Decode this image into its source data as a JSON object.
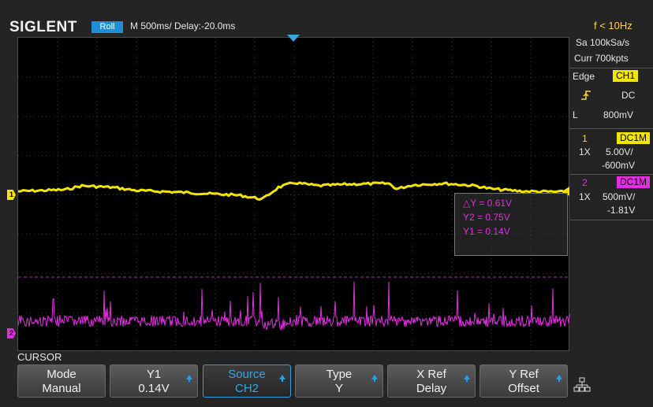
{
  "header": {
    "brand": "SIGLENT",
    "mode": "Roll",
    "timebase": "M 500ms/  Delay:-20.0ms",
    "frequency": "f < 10Hz"
  },
  "acquisition": {
    "sample_rate": "Sa 100kSa/s",
    "memory_depth": "Curr 700kpts"
  },
  "trigger": {
    "type": "Edge",
    "source": "CH1",
    "slope_icon": "rising-edge-icon",
    "coupling": "DC",
    "level_label": "L",
    "level": "800mV"
  },
  "channels": [
    {
      "number": "1",
      "coupling": "DC1M",
      "probe": "1X",
      "scale": "5.00V/",
      "offset": "-600mV",
      "color": "#f2e600",
      "marker": "1"
    },
    {
      "number": "2",
      "coupling": "DC1M",
      "probe": "1X",
      "scale": "500mV/",
      "offset": "-1.81V",
      "color": "#e22ee2",
      "marker": "2"
    }
  ],
  "cursor_readout": {
    "delta_y": "△Y = 0.61V",
    "y2": "Y2 = 0.75V",
    "y1": "Y1 = 0.14V"
  },
  "menu": {
    "title": "CURSOR",
    "softkeys": [
      {
        "line1": "Mode",
        "line2": "Manual"
      },
      {
        "line1": "Y1",
        "line2": "0.14V"
      },
      {
        "line1": "Source",
        "line2": "CH2"
      },
      {
        "line1": "Type",
        "line2": "Y"
      },
      {
        "line1": "X Ref",
        "line2": "Delay"
      },
      {
        "line1": "Y Ref",
        "line2": "Offset"
      }
    ],
    "network_icon": "network-icon"
  },
  "colors": {
    "accent": "#1c8fd6",
    "ch1": "#f2e600",
    "ch2": "#e22ee2",
    "trigger_level": "#ffd24a"
  }
}
